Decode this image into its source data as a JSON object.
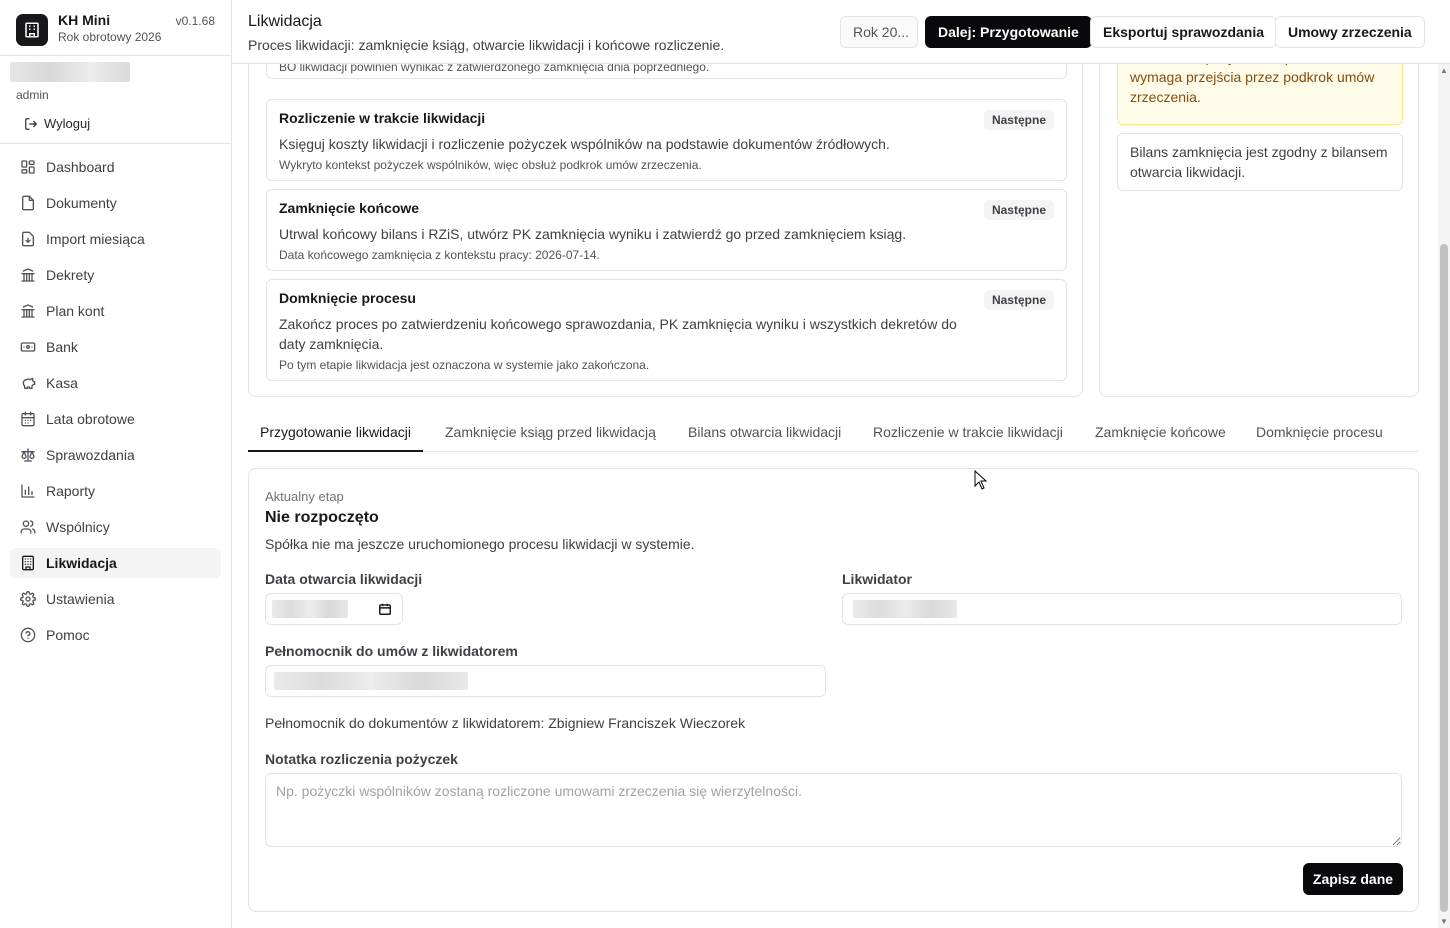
{
  "app": {
    "name": "KH Mini",
    "fiscal_year": "Rok obrotowy 2026",
    "version": "v0.1.68"
  },
  "user": {
    "role": "admin",
    "logout_label": "Wyloguj"
  },
  "sidebar": {
    "items": [
      {
        "label": "Dashboard",
        "icon": "dashboard-icon"
      },
      {
        "label": "Dokumenty",
        "icon": "document-icon"
      },
      {
        "label": "Import miesiąca",
        "icon": "import-icon"
      },
      {
        "label": "Dekrety",
        "icon": "bank-building-icon"
      },
      {
        "label": "Plan kont",
        "icon": "bank-building-icon"
      },
      {
        "label": "Bank",
        "icon": "banknote-icon"
      },
      {
        "label": "Kasa",
        "icon": "piggy-bank-icon"
      },
      {
        "label": "Lata obrotowe",
        "icon": "calendar-icon"
      },
      {
        "label": "Sprawozdania",
        "icon": "scale-icon"
      },
      {
        "label": "Raporty",
        "icon": "bar-chart-icon"
      },
      {
        "label": "Wspólnicy",
        "icon": "users-icon"
      },
      {
        "label": "Likwidacja",
        "icon": "building-icon",
        "active": true
      },
      {
        "label": "Ustawienia",
        "icon": "gear-icon"
      },
      {
        "label": "Pomoc",
        "icon": "help-icon"
      }
    ]
  },
  "header": {
    "title": "Likwidacja",
    "subtitle": "Proces likwidacji: zamknięcie ksiąg, otwarcie likwidacji i końcowe rozliczenie.",
    "year_button": "Rok 20...",
    "next_button": "Dalej: Przygotowanie",
    "export_button": "Eksportuj sprawozdania",
    "contracts_button": "Umowy zrzeczenia"
  },
  "steps": {
    "partial_note": "BO likwidacji powinien wynikać z zatwierdzonego zamknięcia dnia poprzedniego.",
    "items": [
      {
        "title": "Rozliczenie w trakcie likwidacji",
        "badge": "Następne",
        "desc": "Księguj koszty likwidacji i rozliczenie pożyczek wspólników na podstawie dokumentów źródłowych.",
        "note": "Wykryto kontekst pożyczek wspólników, więc obsłuż podkrok umów zrzeczenia."
      },
      {
        "title": "Zamknięcie końcowe",
        "badge": "Następne",
        "desc": "Utrwal końcowy bilans i RZiS, utwórz PK zamknięcia wyniku i zatwierdź go przed zamknięciem ksiąg.",
        "note": "Data końcowego zamknięcia z kontekstu pracy: 2026-07-14."
      },
      {
        "title": "Domknięcie procesu",
        "badge": "Następne",
        "desc": "Zakończ proces po zatwierdzeniu końcowego sprawozdania, PK zamknięcia wyniku i wszystkich dekretów do daty zamknięcia.",
        "note": "Po tym etapie likwidacja jest oznaczona w systemie jako zakończona."
      }
    ]
  },
  "side": {
    "warning": "Rozliczenie pożyczek wspólników wymaga przejścia przez podkrok umów zrzeczenia.",
    "ok": "Bilans zamknięcia jest zgodny z bilansem otwarcia likwidacji."
  },
  "tabs": [
    {
      "label": "Przygotowanie likwidacji",
      "active": true
    },
    {
      "label": "Zamknięcie ksiąg przed likwidacją"
    },
    {
      "label": "Bilans otwarcia likwidacji"
    },
    {
      "label": "Rozliczenie w trakcie likwidacji"
    },
    {
      "label": "Zamknięcie końcowe"
    },
    {
      "label": "Domknięcie procesu"
    }
  ],
  "form": {
    "stage_label": "Aktualny etap",
    "stage_value": "Nie rozpoczęto",
    "stage_desc": "Spółka nie ma jeszcze uruchomionego procesu likwidacji w systemie.",
    "open_date_label": "Data otwarcia likwidacji",
    "liquidator_label": "Likwidator",
    "proxy_label": "Pełnomocnik do umów z likwidatorem",
    "representative_text": "Pełnomocnik do dokumentów z likwidatorem: Zbigniew Franciszek Wieczorek",
    "note_label": "Notatka rozliczenia pożyczek",
    "note_placeholder": "Np. pożyczki wspólników zostaną rozliczone umowami zrzeczenia się wierzytelności.",
    "save_button": "Zapisz dane"
  }
}
